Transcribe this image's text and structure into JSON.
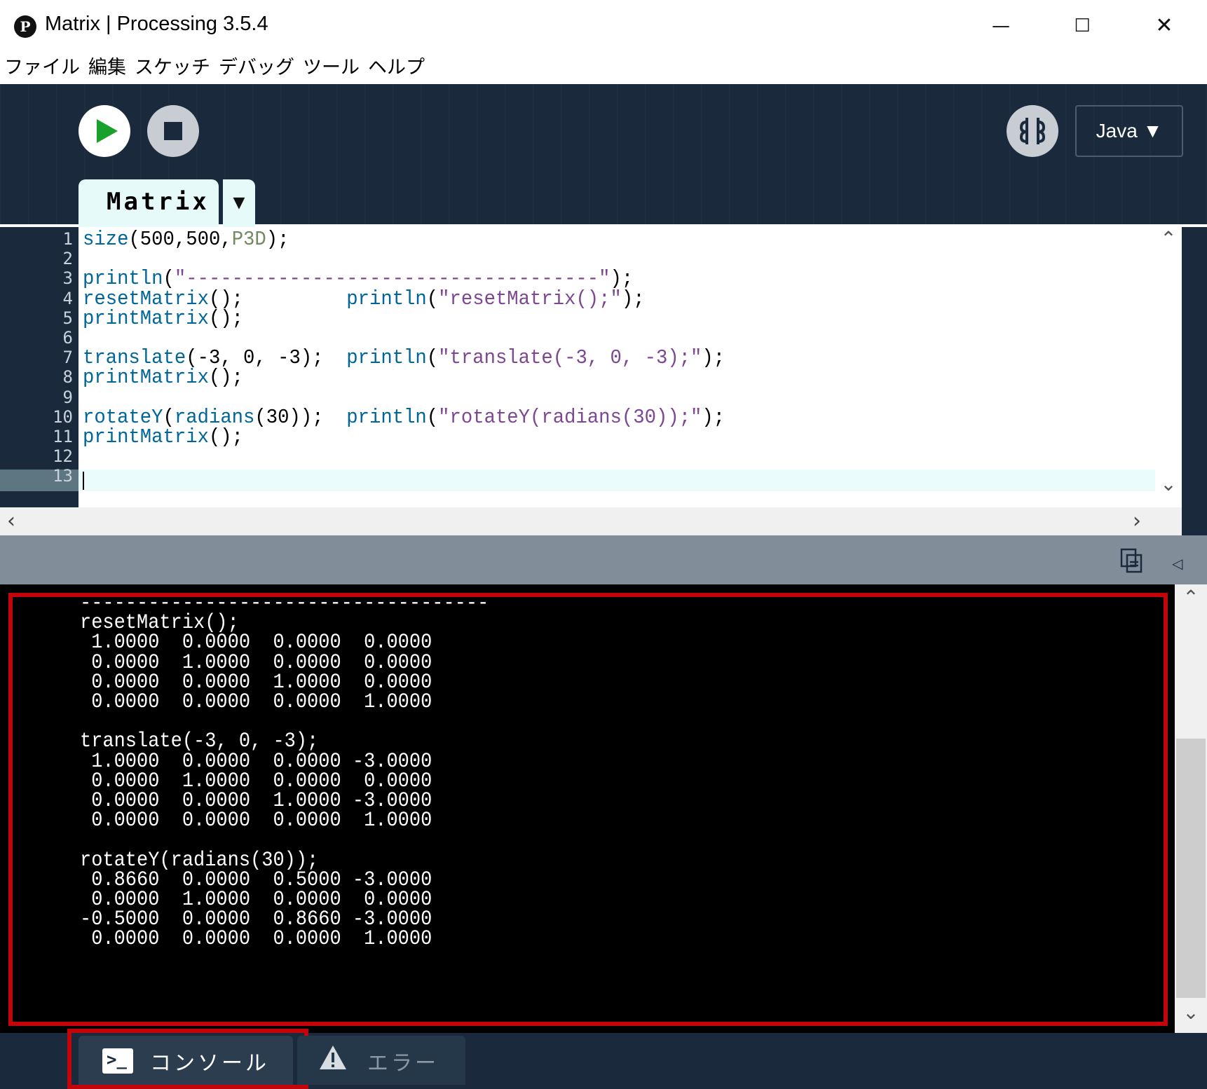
{
  "window": {
    "title": "Matrix | Processing 3.5.4",
    "minimize": "—",
    "maximize": "☐",
    "close": "✕"
  },
  "menu": [
    "ファイル",
    "編集",
    "スケッチ",
    "デバッグ",
    "ツール",
    "ヘルプ"
  ],
  "toolbar": {
    "mode": "Java ▼"
  },
  "tab": {
    "name": "Matrix",
    "menu_icon": "▼"
  },
  "editor": {
    "line_numbers": [
      "1",
      "2",
      "3",
      "4",
      "5",
      "6",
      "7",
      "8",
      "9",
      "10",
      "11",
      "12",
      "13"
    ],
    "current_line": 12,
    "lines": [
      "size(500,500,P3D);",
      "",
      "println(\"------------------------------------\");",
      "resetMatrix();         println(\"resetMatrix();\");",
      "printMatrix();",
      "",
      "translate(-3, 0, -3);  println(\"translate(-3, 0, -3);\");",
      "printMatrix();",
      "",
      "rotateY(radians(30));  println(\"rotateY(radians(30));\");",
      "printMatrix();",
      ""
    ]
  },
  "console": {
    "lines": [
      "------------------------------------",
      "resetMatrix();",
      " 1.0000  0.0000  0.0000  0.0000",
      " 0.0000  1.0000  0.0000  0.0000",
      " 0.0000  0.0000  1.0000  0.0000",
      " 0.0000  0.0000  0.0000  1.0000",
      "",
      "translate(-3, 0, -3);",
      " 1.0000  0.0000  0.0000 -3.0000",
      " 0.0000  1.0000  0.0000  0.0000",
      " 0.0000  0.0000  1.0000 -3.0000",
      " 0.0000  0.0000  0.0000  1.0000",
      "",
      "rotateY(radians(30));",
      " 0.8660  0.0000  0.5000 -3.0000",
      " 0.0000  1.0000  0.0000  0.0000",
      "-0.5000  0.0000  0.8660 -3.0000",
      " 0.0000  0.0000  0.0000  1.0000"
    ]
  },
  "footer": {
    "console_tab": "コンソール",
    "errors_tab": "エラー"
  },
  "icons": {
    "app": "processing-logo-icon",
    "run": "play-icon",
    "stop": "stop-icon",
    "debug": "debugger-icon",
    "copy": "copy-console-icon",
    "collapse": "collapse-triangle-icon",
    "console": "terminal-icon",
    "errors": "warning-icon"
  },
  "colors": {
    "header_bg": "#1a2a3c",
    "accent_run": "#1aa12c",
    "highlight_red": "#c3040a",
    "tab_bg": "#e6fafa"
  }
}
